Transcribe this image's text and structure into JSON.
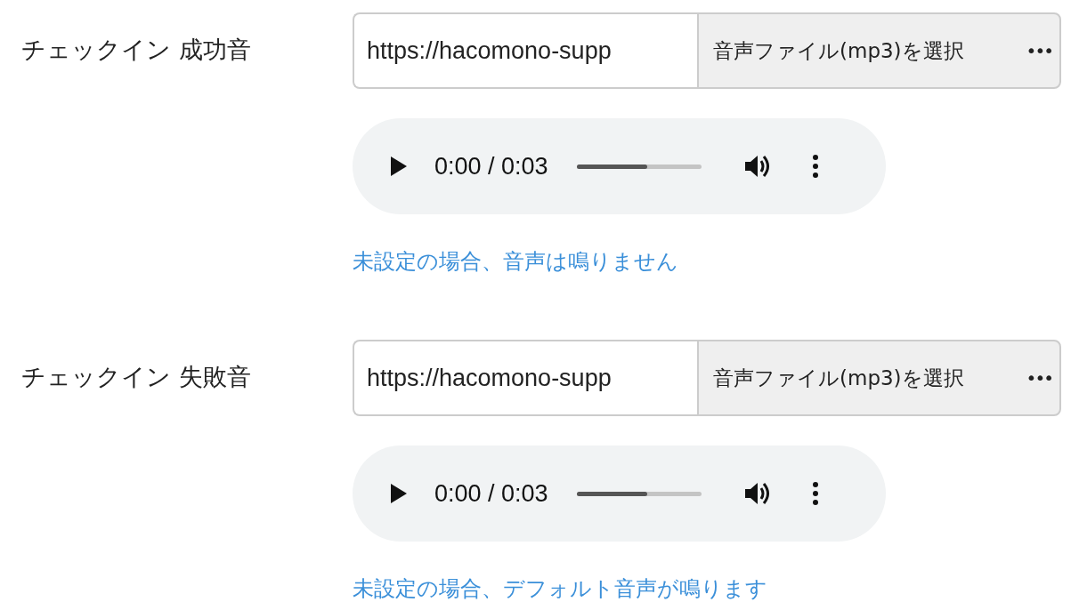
{
  "sections": [
    {
      "label": "チェックイン 成功音",
      "file_field": {
        "value": "https://hacomono-supp"
      },
      "select_button": {
        "label": "音声ファイル(mp3)を選択",
        "more": "•••"
      },
      "player": {
        "time": "0:00 / 0:03",
        "level": 0.57
      },
      "hint": "未設定の場合、音声は鳴りません"
    },
    {
      "label": "チェックイン 失敗音",
      "file_field": {
        "value": "https://hacomono-supp"
      },
      "select_button": {
        "label": "音声ファイル(mp3)を選択",
        "more": "•••"
      },
      "player": {
        "time": "0:00 / 0:03",
        "level": 0.57
      },
      "hint": "未設定の場合、デフォルト音声が鳴ります"
    }
  ]
}
